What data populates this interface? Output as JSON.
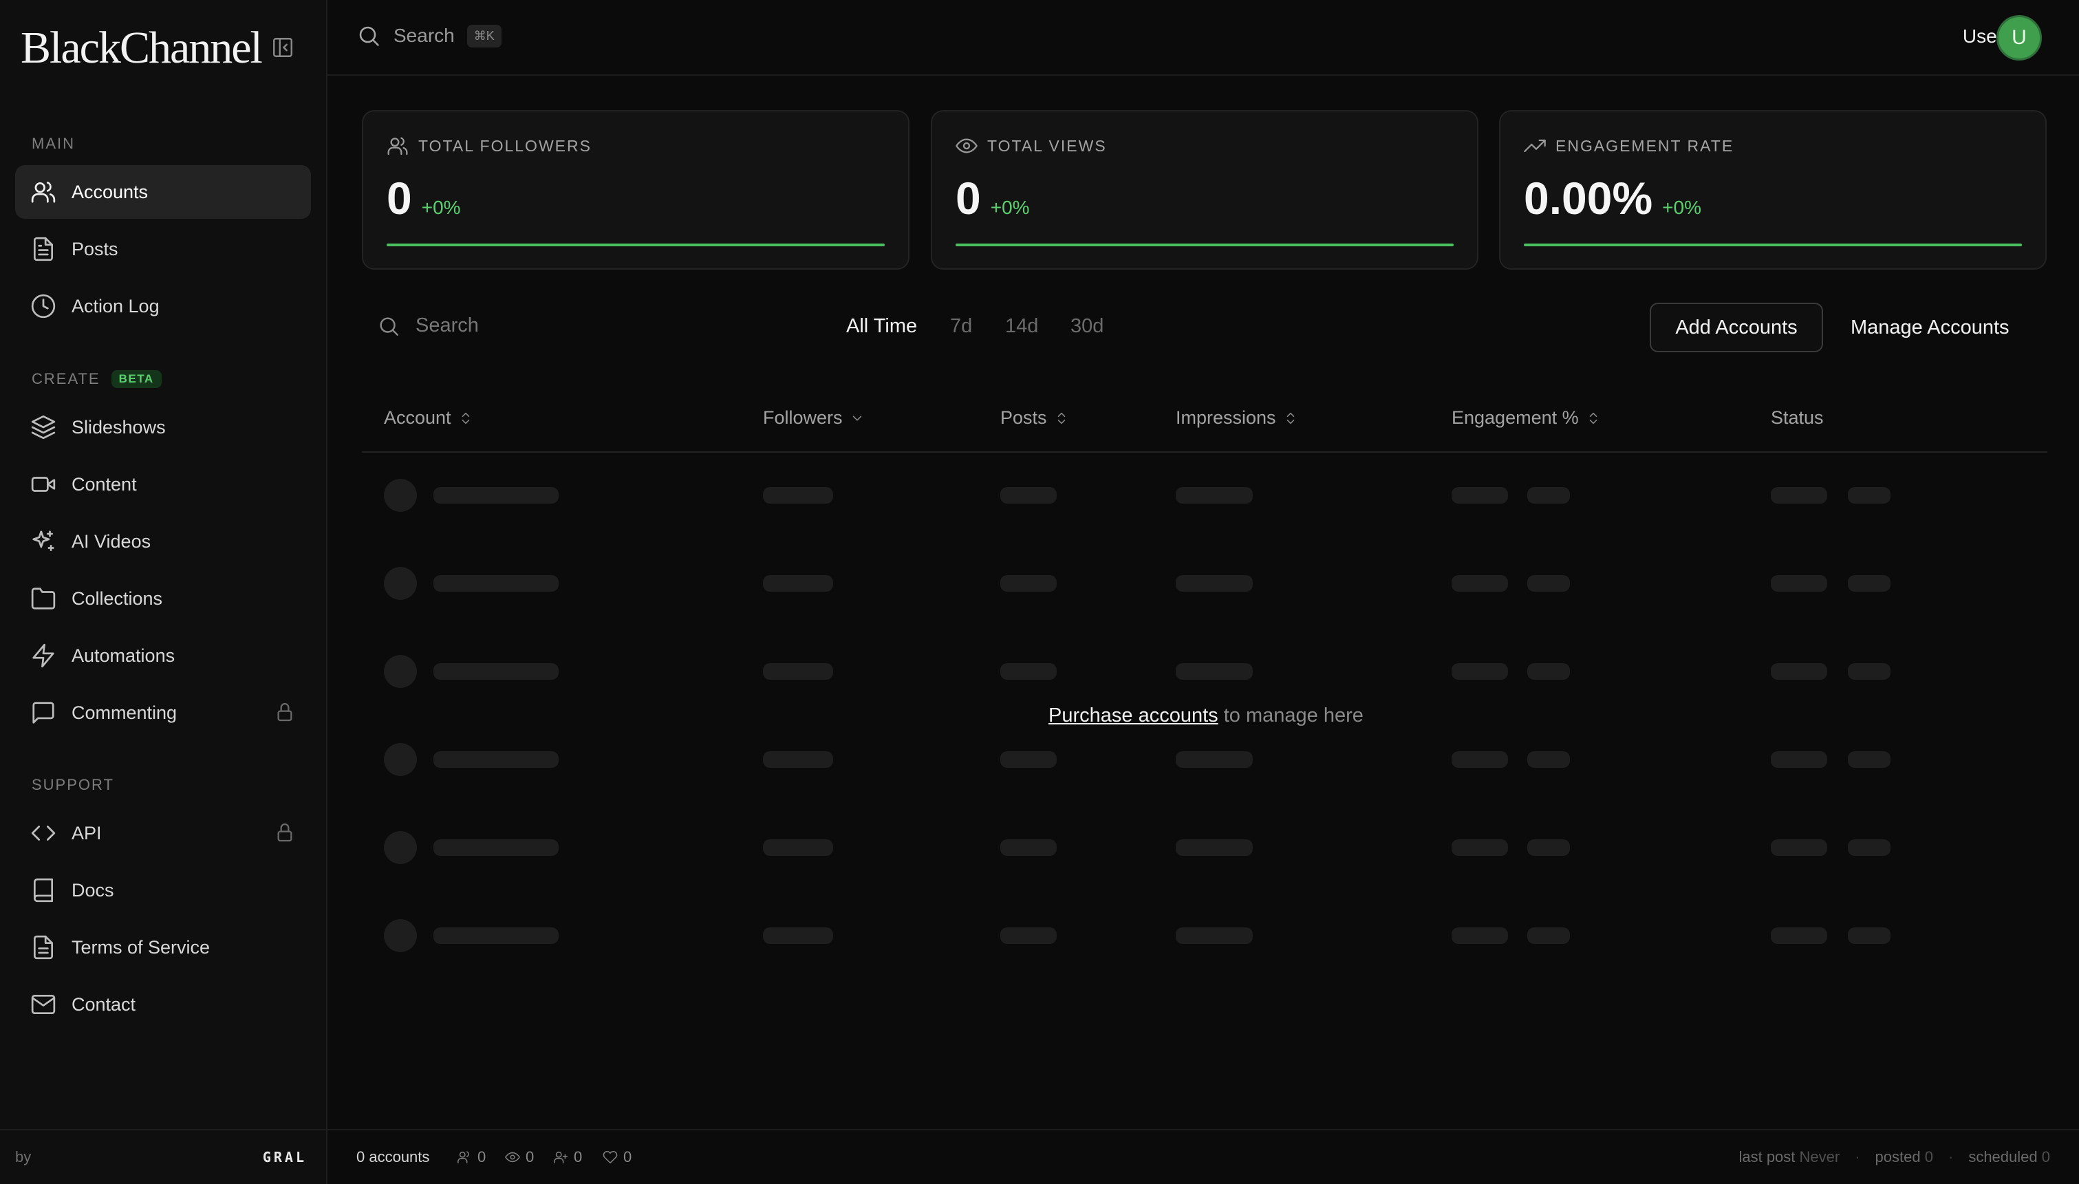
{
  "app": {
    "brand": "BlackChannel",
    "footer_by": "by",
    "footer_brand": "GRAL"
  },
  "sidebar": {
    "sections": {
      "main": "MAIN",
      "create": "CREATE",
      "create_badge": "BETA",
      "support": "SUPPORT"
    },
    "items": [
      {
        "label": "Accounts",
        "icon": "users-icon",
        "active": true
      },
      {
        "label": "Posts",
        "icon": "file-text-icon"
      },
      {
        "label": "Action Log",
        "icon": "clock-icon"
      },
      {
        "label": "Slideshows",
        "icon": "layers-icon"
      },
      {
        "label": "Content",
        "icon": "video-icon"
      },
      {
        "label": "AI Videos",
        "icon": "sparkles-icon"
      },
      {
        "label": "Collections",
        "icon": "folder-icon"
      },
      {
        "label": "Automations",
        "icon": "zap-icon"
      },
      {
        "label": "Commenting",
        "icon": "message-square-icon",
        "locked": true
      },
      {
        "label": "API",
        "icon": "code-icon",
        "locked": true
      },
      {
        "label": "Docs",
        "icon": "book-icon"
      },
      {
        "label": "Terms of Service",
        "icon": "file-text-icon"
      },
      {
        "label": "Contact",
        "icon": "mail-icon"
      }
    ]
  },
  "topbar": {
    "search_label": "Search",
    "shortcut": "⌘K",
    "user_name": "User",
    "avatar_letter": "U"
  },
  "stats": [
    {
      "label": "TOTAL FOLLOWERS",
      "icon": "users-icon",
      "value": "0",
      "delta": "+0%",
      "progress_pct": 100
    },
    {
      "label": "TOTAL VIEWS",
      "icon": "eye-icon",
      "value": "0",
      "delta": "+0%",
      "progress_pct": 100
    },
    {
      "label": "ENGAGEMENT RATE",
      "icon": "trending-up-icon",
      "value": "0.00%",
      "delta": "+0%",
      "progress_pct": 100
    }
  ],
  "toolbar": {
    "search_placeholder": "Search",
    "ranges": [
      "All Time",
      "7d",
      "14d",
      "30d"
    ],
    "active_range": "All Time",
    "add_button": "Add Accounts",
    "manage_button": "Manage Accounts"
  },
  "table": {
    "columns": [
      "Account",
      "Followers",
      "Posts",
      "Impressions",
      "Engagement %",
      "Status"
    ],
    "empty_link": "Purchase accounts",
    "empty_text": " to manage here"
  },
  "statusbar": {
    "accounts": "0 accounts",
    "followers": "0",
    "views": "0",
    "follows": "0",
    "likes": "0",
    "last_post_label": "last post",
    "last_post_value": "Never",
    "posted_label": "posted",
    "posted_value": "0",
    "scheduled_label": "scheduled",
    "scheduled_value": "0"
  },
  "colors": {
    "accent": "#4ac05f",
    "avatar": "#3f9f4d",
    "background": "#0b0b0b"
  }
}
